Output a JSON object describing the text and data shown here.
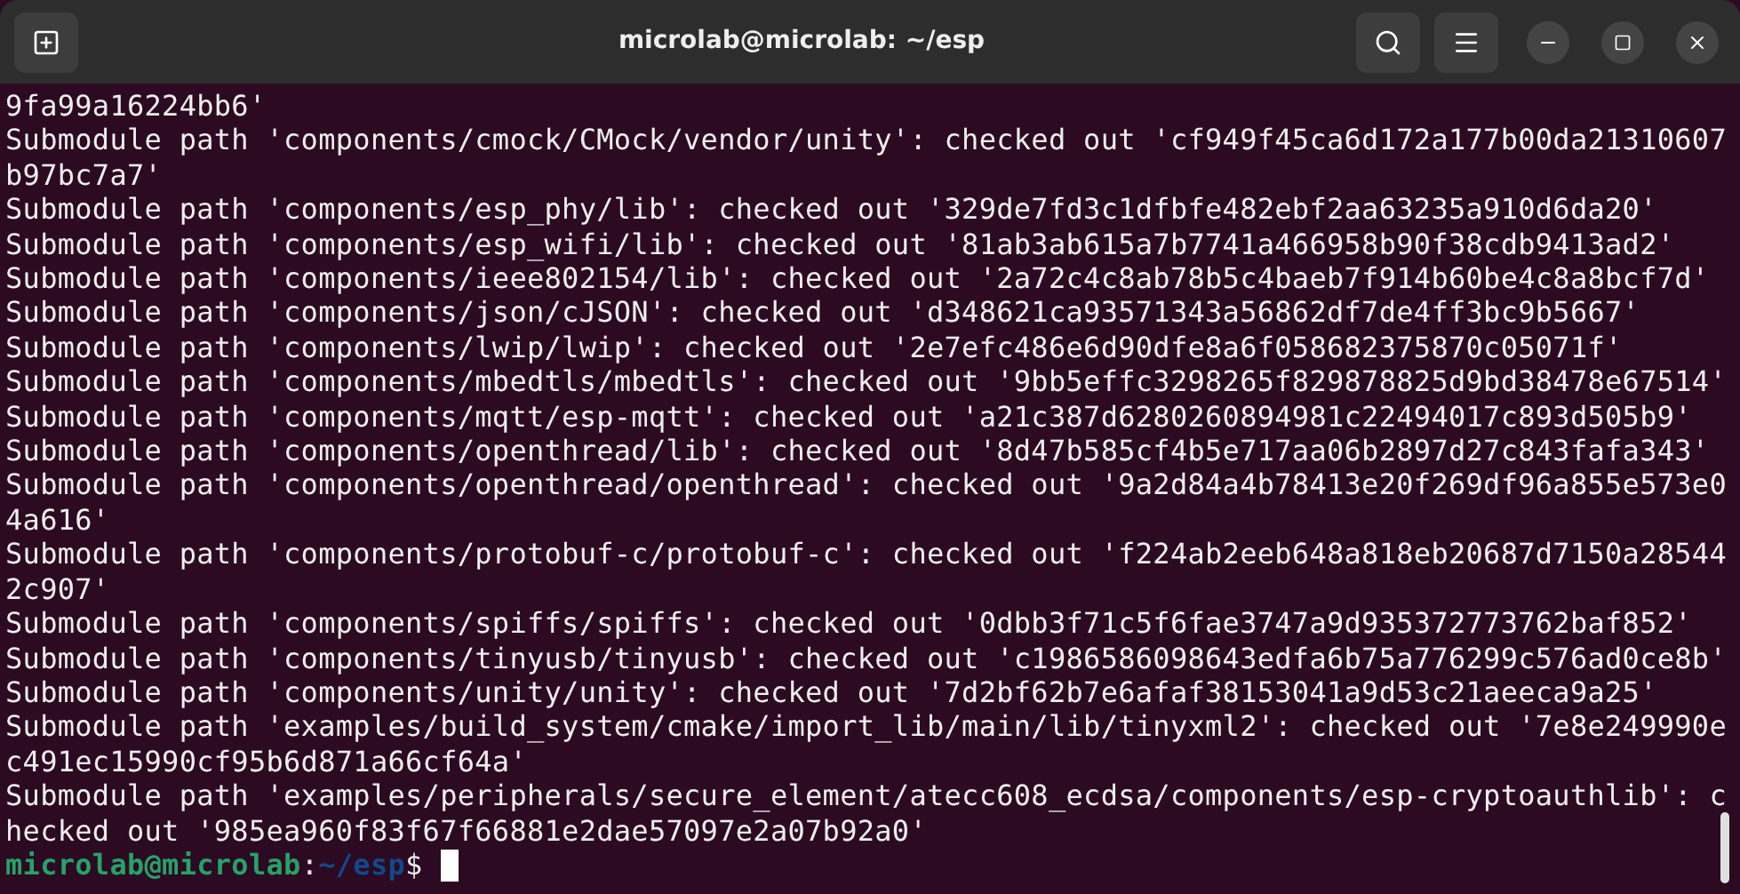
{
  "window": {
    "title": "microlab@microlab: ~/esp"
  },
  "lines": [
    "9fa99a16224bb6'",
    "Submodule path 'components/cmock/CMock/vendor/unity': checked out 'cf949f45ca6d172a177b00da21310607",
    "b97bc7a7'",
    "Submodule path 'components/esp_phy/lib': checked out '329de7fd3c1dfbfe482ebf2aa63235a910d6da20'",
    "Submodule path 'components/esp_wifi/lib': checked out '81ab3ab615a7b7741a466958b90f38cdb9413ad2'",
    "Submodule path 'components/ieee802154/lib': checked out '2a72c4c8ab78b5c4baeb7f914b60be4c8a8bcf7d'",
    "Submodule path 'components/json/cJSON': checked out 'd348621ca93571343a56862df7de4ff3bc9b5667'",
    "Submodule path 'components/lwip/lwip': checked out '2e7efc486e6d90dfe8a6f058682375870c05071f'",
    "Submodule path 'components/mbedtls/mbedtls': checked out '9bb5effc3298265f829878825d9bd38478e67514'",
    "Submodule path 'components/mqtt/esp-mqtt': checked out 'a21c387d6280260894981c22494017c893d505b9'",
    "Submodule path 'components/openthread/lib': checked out '8d47b585cf4b5e717aa06b2897d27c843fafa343'",
    "Submodule path 'components/openthread/openthread': checked out '9a2d84a4b78413e20f269df96a855e573e0",
    "4a616'",
    "Submodule path 'components/protobuf-c/protobuf-c': checked out 'f224ab2eeb648a818eb20687d7150a28544",
    "2c907'",
    "Submodule path 'components/spiffs/spiffs': checked out '0dbb3f71c5f6fae3747a9d935372773762baf852'",
    "Submodule path 'components/tinyusb/tinyusb': checked out 'c1986586098643edfa6b75a776299c576ad0ce8b'",
    "Submodule path 'components/unity/unity': checked out '7d2bf62b7e6afaf38153041a9d53c21aeeca9a25'",
    "Submodule path 'examples/build_system/cmake/import_lib/main/lib/tinyxml2': checked out '7e8e249990e",
    "c491ec15990cf95b6d871a66cf64a'",
    "Submodule path 'examples/peripherals/secure_element/atecc608_ecdsa/components/esp-cryptoauthlib': c",
    "hecked out '985ea960f83f67f66881e2dae57097e2a07b92a0'"
  ],
  "prompt": {
    "user": "microlab@microlab",
    "separator": ":",
    "path": "~/esp",
    "symbol": "$"
  }
}
